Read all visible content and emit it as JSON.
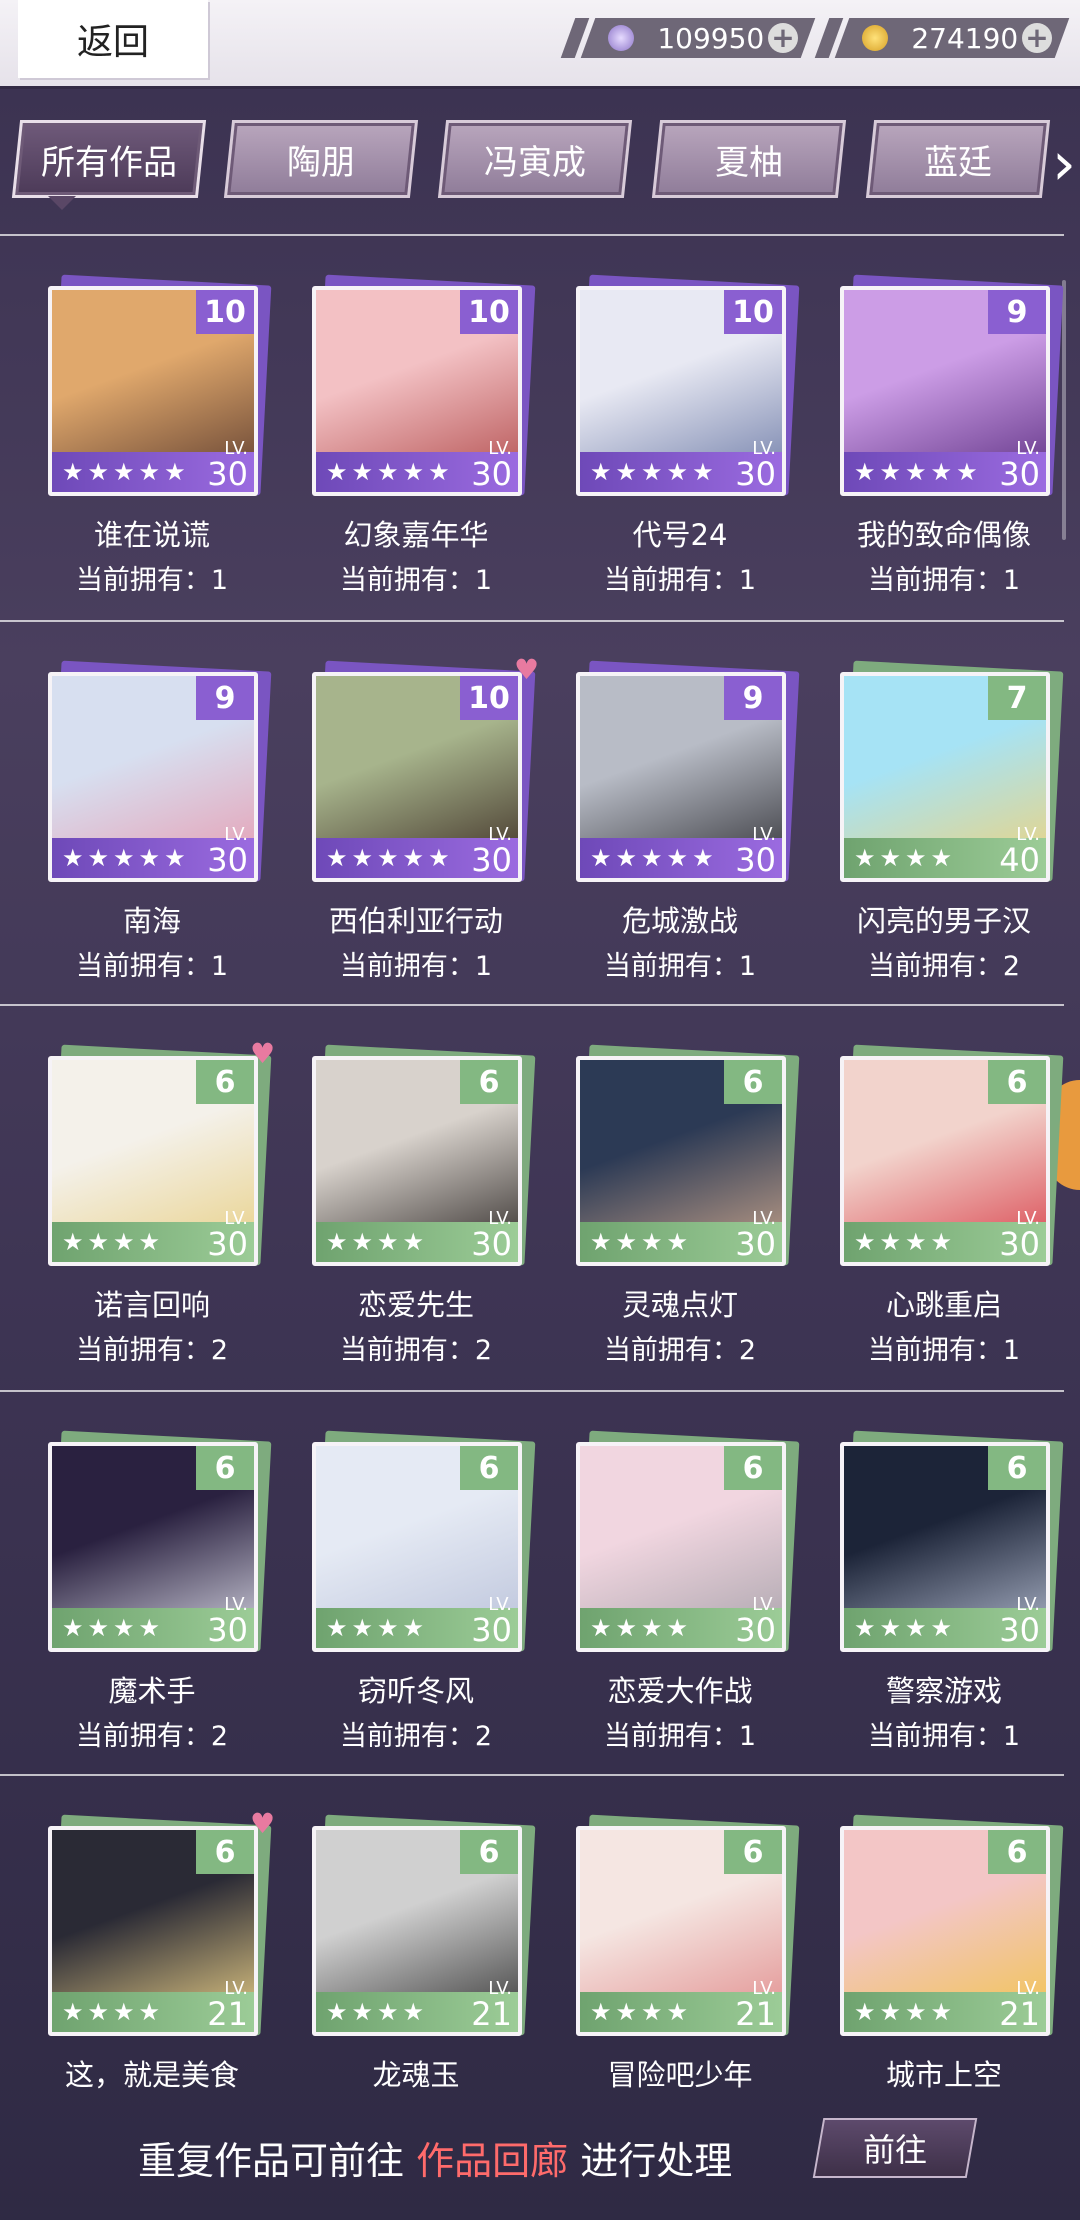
{
  "topbar": {
    "back_label": "返回",
    "diamonds": "109950",
    "coins": "274190",
    "plus": "+"
  },
  "tabs": [
    "所有作品",
    "陶朋",
    "冯寅成",
    "夏柚",
    "蓝廷"
  ],
  "cards": [
    {
      "name": "谁在说谎",
      "own": "当前拥有：1",
      "count": "10",
      "level": "30",
      "stars": 5,
      "color": "purple",
      "heart": false,
      "art": [
        "#e0a86c",
        "#5a3a2e"
      ]
    },
    {
      "name": "幻象嘉年华",
      "own": "当前拥有：1",
      "count": "10",
      "level": "30",
      "stars": 5,
      "color": "purple",
      "heart": false,
      "art": [
        "#f3c1c4",
        "#b04a4a"
      ]
    },
    {
      "name": "代号24",
      "own": "当前拥有：1",
      "count": "10",
      "level": "30",
      "stars": 5,
      "color": "purple",
      "heart": false,
      "art": [
        "#e8e9f3",
        "#6c7aa6"
      ]
    },
    {
      "name": "我的致命偶像",
      "own": "当前拥有：1",
      "count": "9",
      "level": "30",
      "stars": 5,
      "color": "purple",
      "heart": false,
      "art": [
        "#cc9de6",
        "#5a2d80"
      ]
    },
    {
      "name": "南海",
      "own": "当前拥有：1",
      "count": "9",
      "level": "30",
      "stars": 5,
      "color": "purple",
      "heart": false,
      "art": [
        "#d7dff0",
        "#e79bb0"
      ]
    },
    {
      "name": "西伯利亚行动",
      "own": "当前拥有：1",
      "count": "10",
      "level": "30",
      "stars": 5,
      "color": "purple",
      "heart": true,
      "art": [
        "#a7b48c",
        "#3b2a22"
      ]
    },
    {
      "name": "危城激战",
      "own": "当前拥有：1",
      "count": "9",
      "level": "30",
      "stars": 5,
      "color": "purple",
      "heart": false,
      "art": [
        "#b8bcc6",
        "#2e2e33"
      ]
    },
    {
      "name": "闪亮的男子汉",
      "own": "当前拥有：2",
      "count": "7",
      "level": "40",
      "stars": 4,
      "color": "green",
      "heart": false,
      "art": [
        "#a6e3f5",
        "#f0d27a"
      ]
    },
    {
      "name": "诺言回响",
      "own": "当前拥有：2",
      "count": "6",
      "level": "30",
      "stars": 4,
      "color": "green",
      "heart": true,
      "art": [
        "#f4f1ea",
        "#e8cf84"
      ]
    },
    {
      "name": "恋爱先生",
      "own": "当前拥有：2",
      "count": "6",
      "level": "30",
      "stars": 4,
      "color": "green",
      "heart": false,
      "art": [
        "#d8d2cc",
        "#2b2624"
      ]
    },
    {
      "name": "灵魂点灯",
      "own": "当前拥有：2",
      "count": "6",
      "level": "30",
      "stars": 4,
      "color": "green",
      "heart": false,
      "art": [
        "#2c3a55",
        "#c9a58b"
      ]
    },
    {
      "name": "心跳重启",
      "own": "当前拥有：1",
      "count": "6",
      "level": "30",
      "stars": 4,
      "color": "green",
      "heart": false,
      "art": [
        "#f2d3cc",
        "#d8404a"
      ]
    },
    {
      "name": "魔术手",
      "own": "当前拥有：2",
      "count": "6",
      "level": "30",
      "stars": 4,
      "color": "green",
      "heart": false,
      "art": [
        "#2a2140",
        "#d8d8e4"
      ]
    },
    {
      "name": "窃听冬风",
      "own": "当前拥有：2",
      "count": "6",
      "level": "30",
      "stars": 4,
      "color": "green",
      "heart": false,
      "art": [
        "#e5eaf4",
        "#b9c1d9"
      ]
    },
    {
      "name": "恋爱大作战",
      "own": "当前拥有：1",
      "count": "6",
      "level": "30",
      "stars": 4,
      "color": "green",
      "heart": false,
      "art": [
        "#f1d6e0",
        "#a7a2aa"
      ]
    },
    {
      "name": "警察游戏",
      "own": "当前拥有：1",
      "count": "6",
      "level": "30",
      "stars": 4,
      "color": "green",
      "heart": false,
      "art": [
        "#1c2438",
        "#b4bcd0"
      ]
    },
    {
      "name": "这，就是美食",
      "own": "",
      "count": "6",
      "level": "21",
      "stars": 4,
      "color": "green",
      "heart": true,
      "art": [
        "#2a2a35",
        "#f0d58a"
      ]
    },
    {
      "name": "龙魂玉",
      "own": "",
      "count": "6",
      "level": "21",
      "stars": 4,
      "color": "green",
      "heart": false,
      "art": [
        "#d0d0d0",
        "#333"
      ]
    },
    {
      "name": "冒险吧少年",
      "own": "",
      "count": "6",
      "level": "21",
      "stars": 4,
      "color": "green",
      "heart": false,
      "art": [
        "#f5e6e2",
        "#e08a8a"
      ]
    },
    {
      "name": "城市上空",
      "own": "",
      "count": "6",
      "level": "21",
      "stars": 4,
      "color": "green",
      "heart": false,
      "art": [
        "#f3c6c6",
        "#f1c44a"
      ]
    }
  ],
  "lv_label": "LV.",
  "footer": {
    "prefix": "重复作品可前往",
    "highlight": "作品回廊",
    "suffix": "进行处理",
    "button": "前往"
  }
}
